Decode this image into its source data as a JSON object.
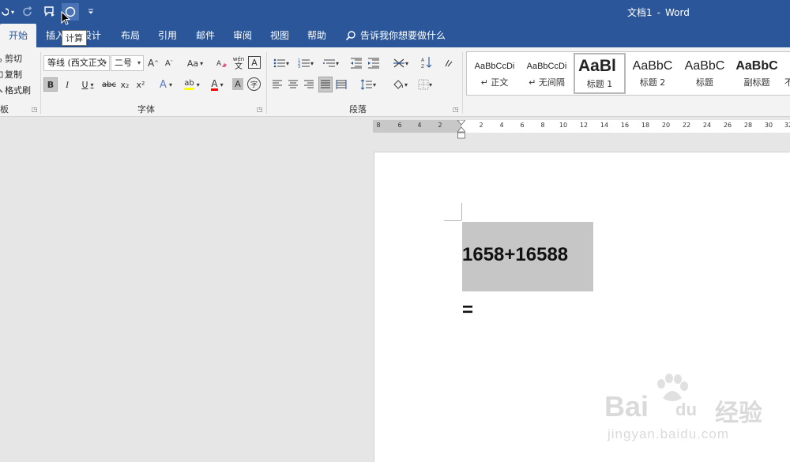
{
  "title_bar": {
    "document_name": "文档1",
    "separator": "-",
    "app_name": "Word"
  },
  "quick_access": {
    "icons": [
      "undo-icon",
      "redo-icon",
      "speech-bubble-icon",
      "calculate-circle-icon",
      "customize-toolbar-icon"
    ],
    "colors": {
      "titlebar": "#2b579a"
    }
  },
  "tooltip": {
    "text": "计算"
  },
  "tabs": [
    {
      "label": "开始",
      "active": true
    },
    {
      "label": "插入"
    },
    {
      "label": "设计"
    },
    {
      "label": "布局"
    },
    {
      "label": "引用"
    },
    {
      "label": "邮件"
    },
    {
      "label": "审阅"
    },
    {
      "label": "视图"
    },
    {
      "label": "帮助"
    }
  ],
  "tell_me": {
    "label": "告诉我你想要做什么"
  },
  "clipboard": {
    "cut": "剪切",
    "copy": "复制",
    "format_painter": "格式刷",
    "group_label_partial": "板"
  },
  "font": {
    "name": "等线 (西文正文",
    "size": "二号",
    "grow": "A",
    "shrink": "A",
    "change_case": "Aa",
    "phonetic_top": "wén",
    "phonetic_bottom": "文",
    "border_char": "A",
    "bold": "B",
    "italic": "I",
    "underline": "U",
    "strike": "abc",
    "subscript": "x₂",
    "superscript": "x²",
    "effects": "A",
    "highlight": "ab",
    "font_color": "A",
    "shading": "A",
    "enclose": "字",
    "group_label": "字体",
    "colors": {
      "highlight": "#ffff00",
      "font_color": "#ff0000"
    }
  },
  "paragraph": {
    "group_label": "段落"
  },
  "styles": [
    {
      "sample": "AaBbCcDi",
      "name": "正文",
      "marker": "↵"
    },
    {
      "sample": "AaBbCcDi",
      "name": "无间隔",
      "marker": "↵"
    },
    {
      "sample": "AaBl",
      "name": "标题 1",
      "selected": true
    },
    {
      "sample": "AaBbC",
      "name": "标题 2"
    },
    {
      "sample": "AaBbC",
      "name": "标题"
    },
    {
      "sample": "AaBbC",
      "name": "副标题"
    },
    {
      "sample": "不",
      "name": ""
    }
  ],
  "ruler": {
    "left_numbers": [
      "8",
      "6",
      "4",
      "2"
    ],
    "right_numbers": [
      "2",
      "4",
      "6",
      "8",
      "10",
      "12",
      "14",
      "16",
      "18",
      "20",
      "22",
      "24",
      "26",
      "28",
      "30",
      "32"
    ]
  },
  "document": {
    "expression": "1658+16588",
    "equals": "=",
    "selection_color": "#c6c6c6"
  },
  "watermark": {
    "brand": "Bai",
    "brand2": "du",
    "cn": "经验",
    "url": "jingyan.baidu.com"
  }
}
